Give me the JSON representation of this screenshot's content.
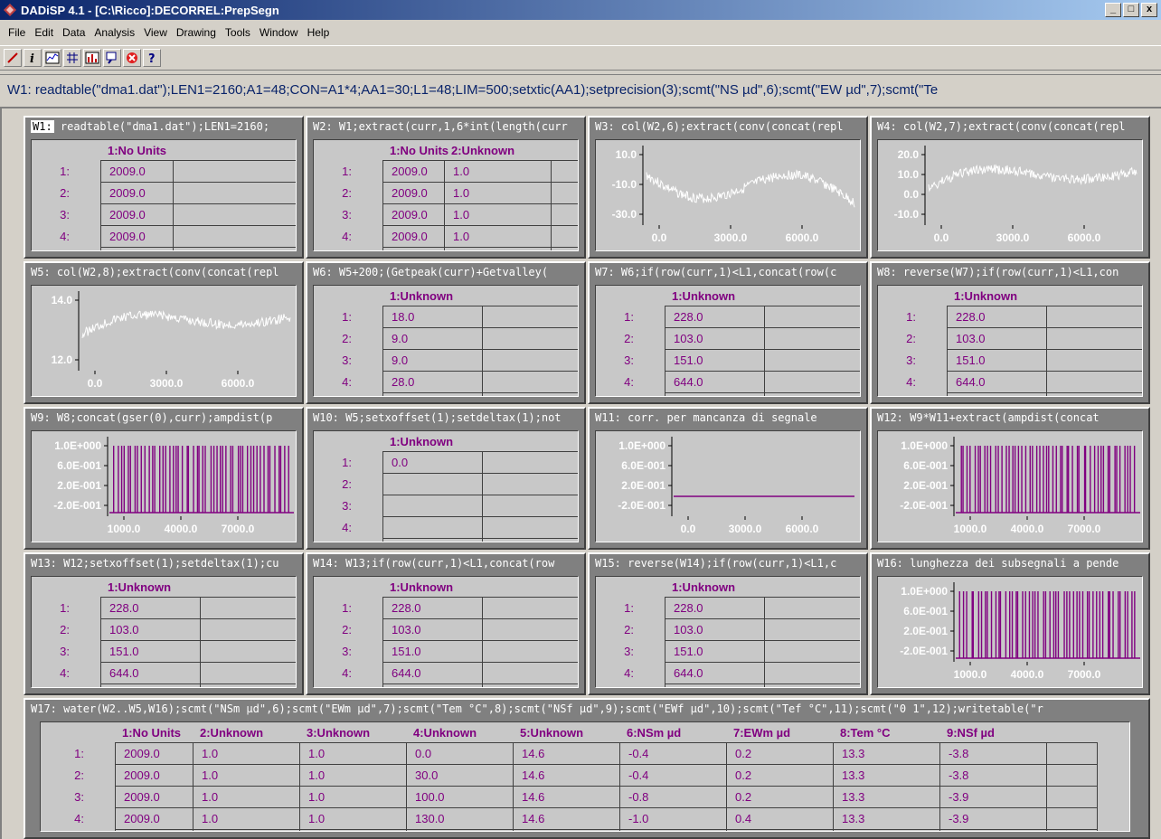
{
  "app": {
    "title": "DADiSP 4.1 - [C:\\Ricco]:DECORREL:PrepSegn",
    "window_buttons": [
      "_",
      "□",
      "x"
    ]
  },
  "menu": [
    "File",
    "Edit",
    "Data",
    "Analysis",
    "View",
    "Drawing",
    "Tools",
    "Window",
    "Help"
  ],
  "toolbar": [
    "pencil-icon",
    "info-icon",
    "chart-icon",
    "grid-icon",
    "histogram-icon",
    "zoom-icon",
    "stop-icon",
    "help-icon"
  ],
  "command": "W1: readtable(\"dma1.dat\");LEN1=2160;A1=48;CON=A1*4;AA1=30;L1=48;LIM=500;setxtic(AA1);setprecision(3);scmt(\"NS µd\",6);scmt(\"EW µd\",7);scmt(\"Te",
  "windows": {
    "w1": {
      "id": "W1:",
      "title": " readtable(\"dma1.dat\");LEN1=2160;",
      "headers": [
        "1:No Units"
      ],
      "rows": [
        "1:",
        "2:",
        "3:",
        "4:"
      ],
      "cells": [
        [
          "2009.0"
        ],
        [
          "2009.0"
        ],
        [
          "2009.0"
        ],
        [
          "2009.0"
        ]
      ]
    },
    "w2": {
      "title": "W2: W1;extract(curr,1,6*int(length(curr",
      "headers": [
        "1:No Units",
        "2:Unknown"
      ],
      "rows": [
        "1:",
        "2:",
        "3:",
        "4:"
      ],
      "cells": [
        [
          "2009.0",
          "1.0"
        ],
        [
          "2009.0",
          "1.0"
        ],
        [
          "2009.0",
          "1.0"
        ],
        [
          "2009.0",
          "1.0"
        ]
      ]
    },
    "w3": {
      "title": "W3: col(W2,6);extract(conv(concat(repl",
      "yticks": [
        "10.0",
        "-10.0",
        "-30.0"
      ],
      "xticks": [
        "0.0",
        "3000.0",
        "6000.0"
      ]
    },
    "w4": {
      "title": "W4: col(W2,7);extract(conv(concat(repl",
      "yticks": [
        "20.0",
        "10.0",
        "0.0",
        "-10.0"
      ],
      "xticks": [
        "0.0",
        "3000.0",
        "6000.0"
      ]
    },
    "w5": {
      "title": "W5: col(W2,8);extract(conv(concat(repl",
      "yticks": [
        "14.0",
        "12.0"
      ],
      "xticks": [
        "0.0",
        "3000.0",
        "6000.0"
      ]
    },
    "w6": {
      "title": "W6: W5+200;(Getpeak(curr)+Getvalley(",
      "headers": [
        "1:Unknown"
      ],
      "rows": [
        "1:",
        "2:",
        "3:",
        "4:"
      ],
      "cells": [
        [
          "18.0"
        ],
        [
          "9.0"
        ],
        [
          "9.0"
        ],
        [
          "28.0"
        ]
      ]
    },
    "w7": {
      "title": "W7: W6;if(row(curr,1)<L1,concat(row(c",
      "headers": [
        "1:Unknown"
      ],
      "rows": [
        "1:",
        "2:",
        "3:",
        "4:"
      ],
      "cells": [
        [
          "228.0"
        ],
        [
          "103.0"
        ],
        [
          "151.0"
        ],
        [
          "644.0"
        ]
      ]
    },
    "w8": {
      "title": "W8: reverse(W7);if(row(curr,1)<L1,con",
      "headers": [
        "1:Unknown"
      ],
      "rows": [
        "1:",
        "2:",
        "3:",
        "4:"
      ],
      "cells": [
        [
          "228.0"
        ],
        [
          "103.0"
        ],
        [
          "151.0"
        ],
        [
          "644.0"
        ]
      ]
    },
    "w9": {
      "title": "W9: W8;concat(gser(0),curr);ampdist(p",
      "yticks": [
        "1.0E+000",
        "6.0E-001",
        "2.0E-001",
        "-2.0E-001"
      ],
      "xticks": [
        "1000.0",
        "4000.0",
        "7000.0"
      ]
    },
    "w10": {
      "title": "W10: W5;setxoffset(1);setdeltax(1);not",
      "headers": [
        "1:Unknown"
      ],
      "rows": [
        "1:",
        "2:",
        "3:",
        "4:"
      ],
      "cells": [
        [
          "0.0"
        ],
        [
          ""
        ],
        [
          ""
        ],
        [
          ""
        ]
      ]
    },
    "w11": {
      "title": "W11: corr. per mancanza di segnale",
      "yticks": [
        "1.0E+000",
        "6.0E-001",
        "2.0E-001",
        "-2.0E-001"
      ],
      "xticks": [
        "0.0",
        "3000.0",
        "6000.0"
      ]
    },
    "w12": {
      "title": "W12: W9*W11+extract(ampdist(concat",
      "yticks": [
        "1.0E+000",
        "6.0E-001",
        "2.0E-001",
        "-2.0E-001"
      ],
      "xticks": [
        "1000.0",
        "4000.0",
        "7000.0"
      ]
    },
    "w13": {
      "title": "W13: W12;setxoffset(1);setdeltax(1);cu",
      "headers": [
        "1:Unknown"
      ],
      "rows": [
        "1:",
        "2:",
        "3:",
        "4:"
      ],
      "cells": [
        [
          "228.0"
        ],
        [
          "103.0"
        ],
        [
          "151.0"
        ],
        [
          "644.0"
        ]
      ]
    },
    "w14": {
      "title": "W14: W13;if(row(curr,1)<L1,concat(row",
      "headers": [
        "1:Unknown"
      ],
      "rows": [
        "1:",
        "2:",
        "3:",
        "4:"
      ],
      "cells": [
        [
          "228.0"
        ],
        [
          "103.0"
        ],
        [
          "151.0"
        ],
        [
          "644.0"
        ]
      ]
    },
    "w15": {
      "title": "W15: reverse(W14);if(row(curr,1)<L1,c",
      "headers": [
        "1:Unknown"
      ],
      "rows": [
        "1:",
        "2:",
        "3:",
        "4:"
      ],
      "cells": [
        [
          "228.0"
        ],
        [
          "103.0"
        ],
        [
          "151.0"
        ],
        [
          "644.0"
        ]
      ]
    },
    "w16": {
      "title": "W16: lunghezza dei subsegnali  a pende",
      "yticks": [
        "1.0E+000",
        "6.0E-001",
        "2.0E-001",
        "-2.0E-001"
      ],
      "xticks": [
        "1000.0",
        "4000.0",
        "7000.0"
      ]
    },
    "w17": {
      "title": "W17: water(W2..W5,W16);scmt(\"NSm µd\",6);scmt(\"EWm µd\",7);scmt(\"Tem °C\",8);scmt(\"NSf µd\",9);scmt(\"EWf µd\",10);scmt(\"Tef °C\",11);scmt(\"0 1\",12);writetable(\"r",
      "headers": [
        "1:No Units",
        "2:Unknown",
        "3:Unknown",
        "4:Unknown",
        "5:Unknown",
        "6:NSm µd",
        "7:EWm µd",
        "8:Tem °C",
        "9:NSf µd"
      ],
      "rows": [
        "1:",
        "2:",
        "3:",
        "4:"
      ],
      "cells": [
        [
          "2009.0",
          "1.0",
          "1.0",
          "0.0",
          "14.6",
          "-0.4",
          "0.2",
          "13.3",
          "-3.8"
        ],
        [
          "2009.0",
          "1.0",
          "1.0",
          "30.0",
          "14.6",
          "-0.4",
          "0.2",
          "13.3",
          "-3.8"
        ],
        [
          "2009.0",
          "1.0",
          "1.0",
          "100.0",
          "14.6",
          "-0.8",
          "0.2",
          "13.3",
          "-3.9"
        ],
        [
          "2009.0",
          "1.0",
          "1.0",
          "130.0",
          "14.6",
          "-1.0",
          "0.4",
          "13.3",
          "-3.9"
        ]
      ]
    }
  }
}
